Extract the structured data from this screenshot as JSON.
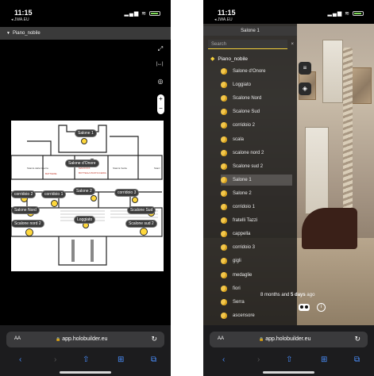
{
  "left": {
    "status": {
      "time": "11:15",
      "back": "◂ JWA.EU",
      "signal": "▂▄▆ ≋"
    },
    "floor_header": {
      "arrow": "▼",
      "label": "Piano_nobile"
    },
    "tools": {
      "expand": "⤢",
      "measure": "|↔|",
      "locate": "◎",
      "zoom_in": "+",
      "zoom_out": "−",
      "menu": "≡"
    },
    "plan_text": {
      "t1": "Stanza della Guerra",
      "t2": "Stanza Verde",
      "t3": "MAXXXXX",
      "t4": "MAXXXXX",
      "t5": "BATTERIE",
      "t6": "BOTTEGA PASTICCERIA",
      "t7": "Stanz"
    },
    "pins": {
      "p1": "Salone 1",
      "p2": "Salone d'Onore",
      "p3": "Salone 2",
      "p4": "corridoio 3",
      "p5": "corridoio 2",
      "p6": "corridoio 1",
      "p7": "Salone Nord",
      "p8": "Scalone Sud",
      "p9": "Loggiato",
      "p10": "Scalone nord 2",
      "p11": "Scalone sud 2"
    }
  },
  "right": {
    "status": {
      "time": "11:15",
      "back": "◂ JWA.EU",
      "signal": "▂▄▆ ≋"
    },
    "sidebar": {
      "title": "Salone 1",
      "search_placeholder": "Search",
      "close": "×",
      "root": "Piano_nobile",
      "items": [
        "Salone d'Onore",
        "Loggiato",
        "Scalone Nord",
        "Scalone Sud",
        "corridoio 2",
        "scala",
        "scalone nord 2",
        "Scalone sud 2",
        "Salone 1",
        "Salone 2",
        "corridoio 1",
        "fratelli Tazzi",
        "cappella",
        "corridoio 3",
        "gigli",
        "medaglie",
        "fiori",
        "Serra",
        "ascensore"
      ],
      "selected_index": 8
    },
    "view_buttons": {
      "list": "≡",
      "layers": "◈"
    },
    "timestamp": {
      "prefix": "8 months and",
      "bold": "5 days",
      "suffix": "ago"
    }
  },
  "browser": {
    "aa": "AA",
    "url": "app.holobuilder.eu",
    "lock": "🔒",
    "reload": "↻",
    "nav": {
      "back": "‹",
      "forward": "›",
      "share": "⇧",
      "bookmarks": "⊞",
      "tabs": "⧉"
    }
  },
  "colors": {
    "accent": "#f5d13b",
    "pin": "#ffd83b",
    "link": "#4a90ff"
  }
}
